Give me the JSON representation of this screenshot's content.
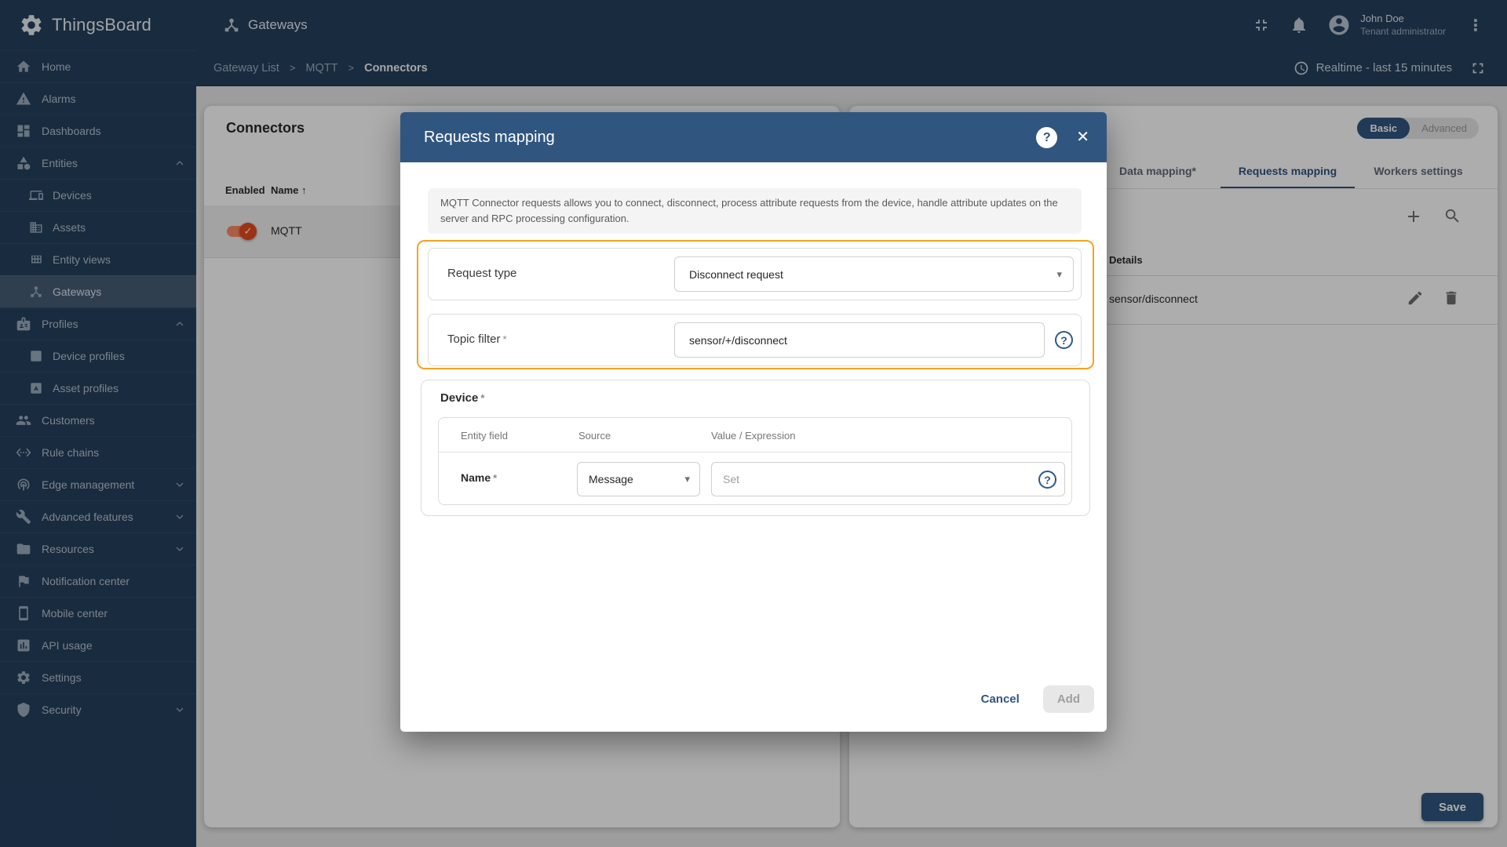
{
  "brand": {
    "name": "ThingsBoard"
  },
  "header": {
    "title": "Gateways",
    "breadcrumb": [
      "Gateway List",
      "MQTT",
      "Connectors"
    ],
    "breadcrumb_separator": ">",
    "user": {
      "name": "John Doe",
      "role": "Tenant administrator"
    },
    "time_range": "Realtime - last 15 minutes"
  },
  "sidebar": {
    "items": [
      {
        "label": "Home"
      },
      {
        "label": "Alarms"
      },
      {
        "label": "Dashboards"
      },
      {
        "label": "Entities"
      },
      {
        "label": "Devices"
      },
      {
        "label": "Assets"
      },
      {
        "label": "Entity views"
      },
      {
        "label": "Gateways"
      },
      {
        "label": "Profiles"
      },
      {
        "label": "Device profiles"
      },
      {
        "label": "Asset profiles"
      },
      {
        "label": "Customers"
      },
      {
        "label": "Rule chains"
      },
      {
        "label": "Edge management"
      },
      {
        "label": "Advanced features"
      },
      {
        "label": "Resources"
      },
      {
        "label": "Notification center"
      },
      {
        "label": "Mobile center"
      },
      {
        "label": "API usage"
      },
      {
        "label": "Settings"
      },
      {
        "label": "Security"
      }
    ]
  },
  "connectors_panel": {
    "title": "Connectors",
    "columns": {
      "enabled": "Enabled",
      "name": "Name"
    },
    "rows": [
      {
        "name": "MQTT",
        "enabled": true
      }
    ]
  },
  "right_panel": {
    "mode_toggle": {
      "basic": "Basic",
      "advanced": "Advanced",
      "active": "Basic"
    },
    "tabs": [
      {
        "label": "Data mapping*"
      },
      {
        "label": "Requests mapping"
      },
      {
        "label": "Workers settings"
      }
    ],
    "active_tab": "Requests mapping",
    "details_header": "Details",
    "rows": [
      {
        "details": "sensor/disconnect"
      }
    ],
    "save_label": "Save"
  },
  "modal": {
    "title": "Requests mapping",
    "info": "MQTT Connector requests allows you to connect, disconnect, process attribute requests from the device, handle attribute updates on the server and RPC processing configuration.",
    "required_marker": "*",
    "request_type": {
      "label": "Request type",
      "value": "Disconnect request"
    },
    "topic_filter": {
      "label": "Topic filter",
      "value": "sensor/+/disconnect"
    },
    "device": {
      "label": "Device",
      "columns": [
        "Entity field",
        "Source",
        "Value / Expression"
      ],
      "row": {
        "field": "Name",
        "source": "Message",
        "value_placeholder": "Set"
      }
    },
    "cancel_label": "Cancel",
    "add_label": "Add"
  },
  "icons": {
    "more_vert": "⋮",
    "sort_asc": "↑",
    "close": "✕",
    "help": "?",
    "caret": "▾",
    "check": "✓"
  },
  "colors": {
    "primary": "#305680",
    "sidebar_bg": "#25405e",
    "highlight_border": "#f3a41e",
    "toggle_on": "#e8491c",
    "toggle_track": "#ff8a65"
  }
}
